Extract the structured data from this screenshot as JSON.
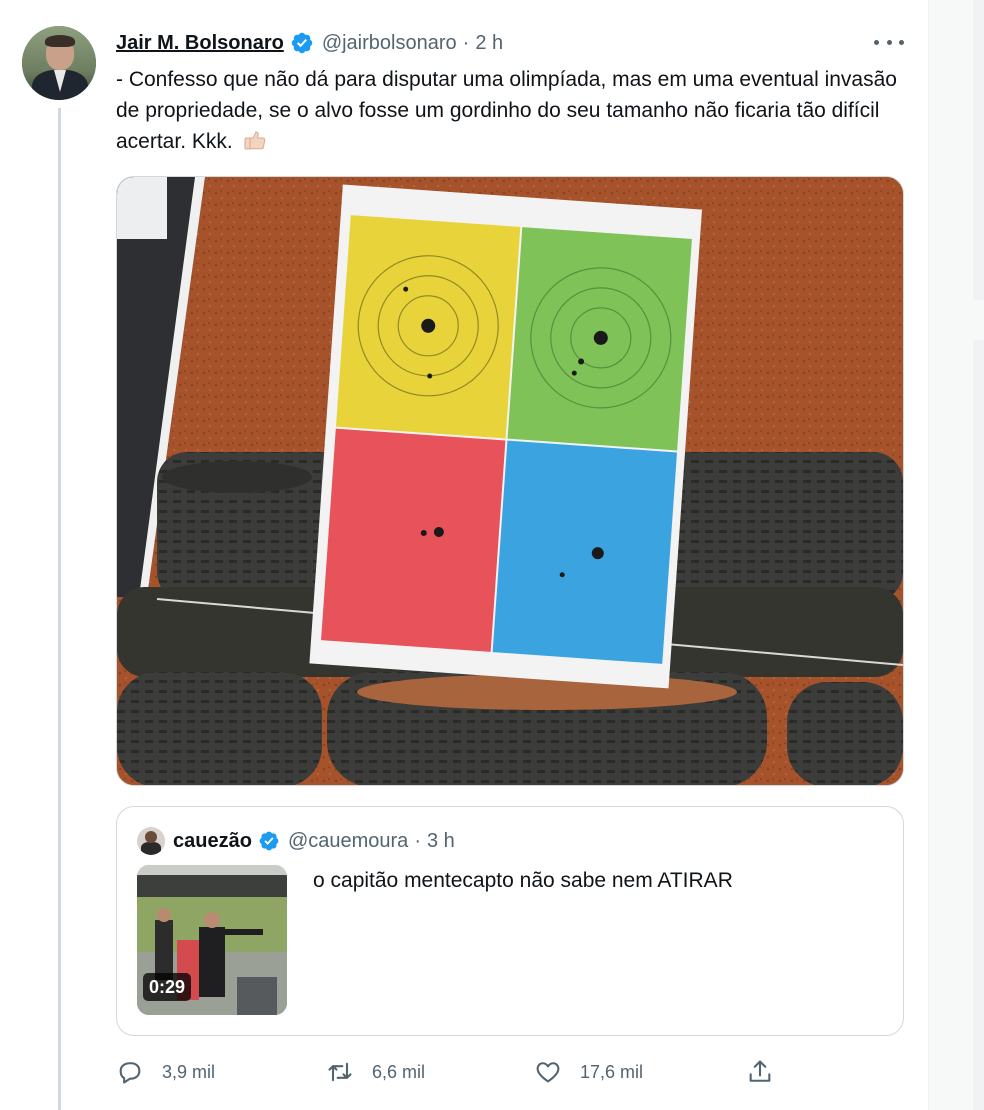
{
  "tweet": {
    "author_name": "Jair M. Bolsonaro",
    "handle": "@jairbolsonaro",
    "separator": "·",
    "time": "2 h",
    "text": "- Confesso que não dá para disputar uma olimpíada, mas em uma eventual invasão de propriedade, se o alvo fosse um gordinho do seu tamanho não ficaria tão difícil acertar. Kkk.",
    "emoji_icon": "thumbs-up-icon",
    "verified_color": "#1d9bf0",
    "media_description_icon": "target-photo"
  },
  "quoted_tweet": {
    "author_name": "cauezão",
    "handle": "@cauemoura",
    "separator": "·",
    "time": "3 h",
    "text": "o capitão mentecapto não sabe nem ATIRAR",
    "video_duration": "0:29"
  },
  "actions": {
    "reply_count": "3,9 mil",
    "retweet_count": "6,6 mil",
    "like_count": "17,6 mil",
    "reply_icon": "reply-icon",
    "retweet_icon": "retweet-icon",
    "like_icon": "heart-icon",
    "share_icon": "share-icon"
  },
  "colors": {
    "text_primary": "#0f1419",
    "text_secondary": "#536471",
    "border": "#cfd9de",
    "target_yellow": "#e8d43a",
    "target_green": "#7fc257",
    "target_red": "#e8525a",
    "target_blue": "#3aa3e0"
  }
}
